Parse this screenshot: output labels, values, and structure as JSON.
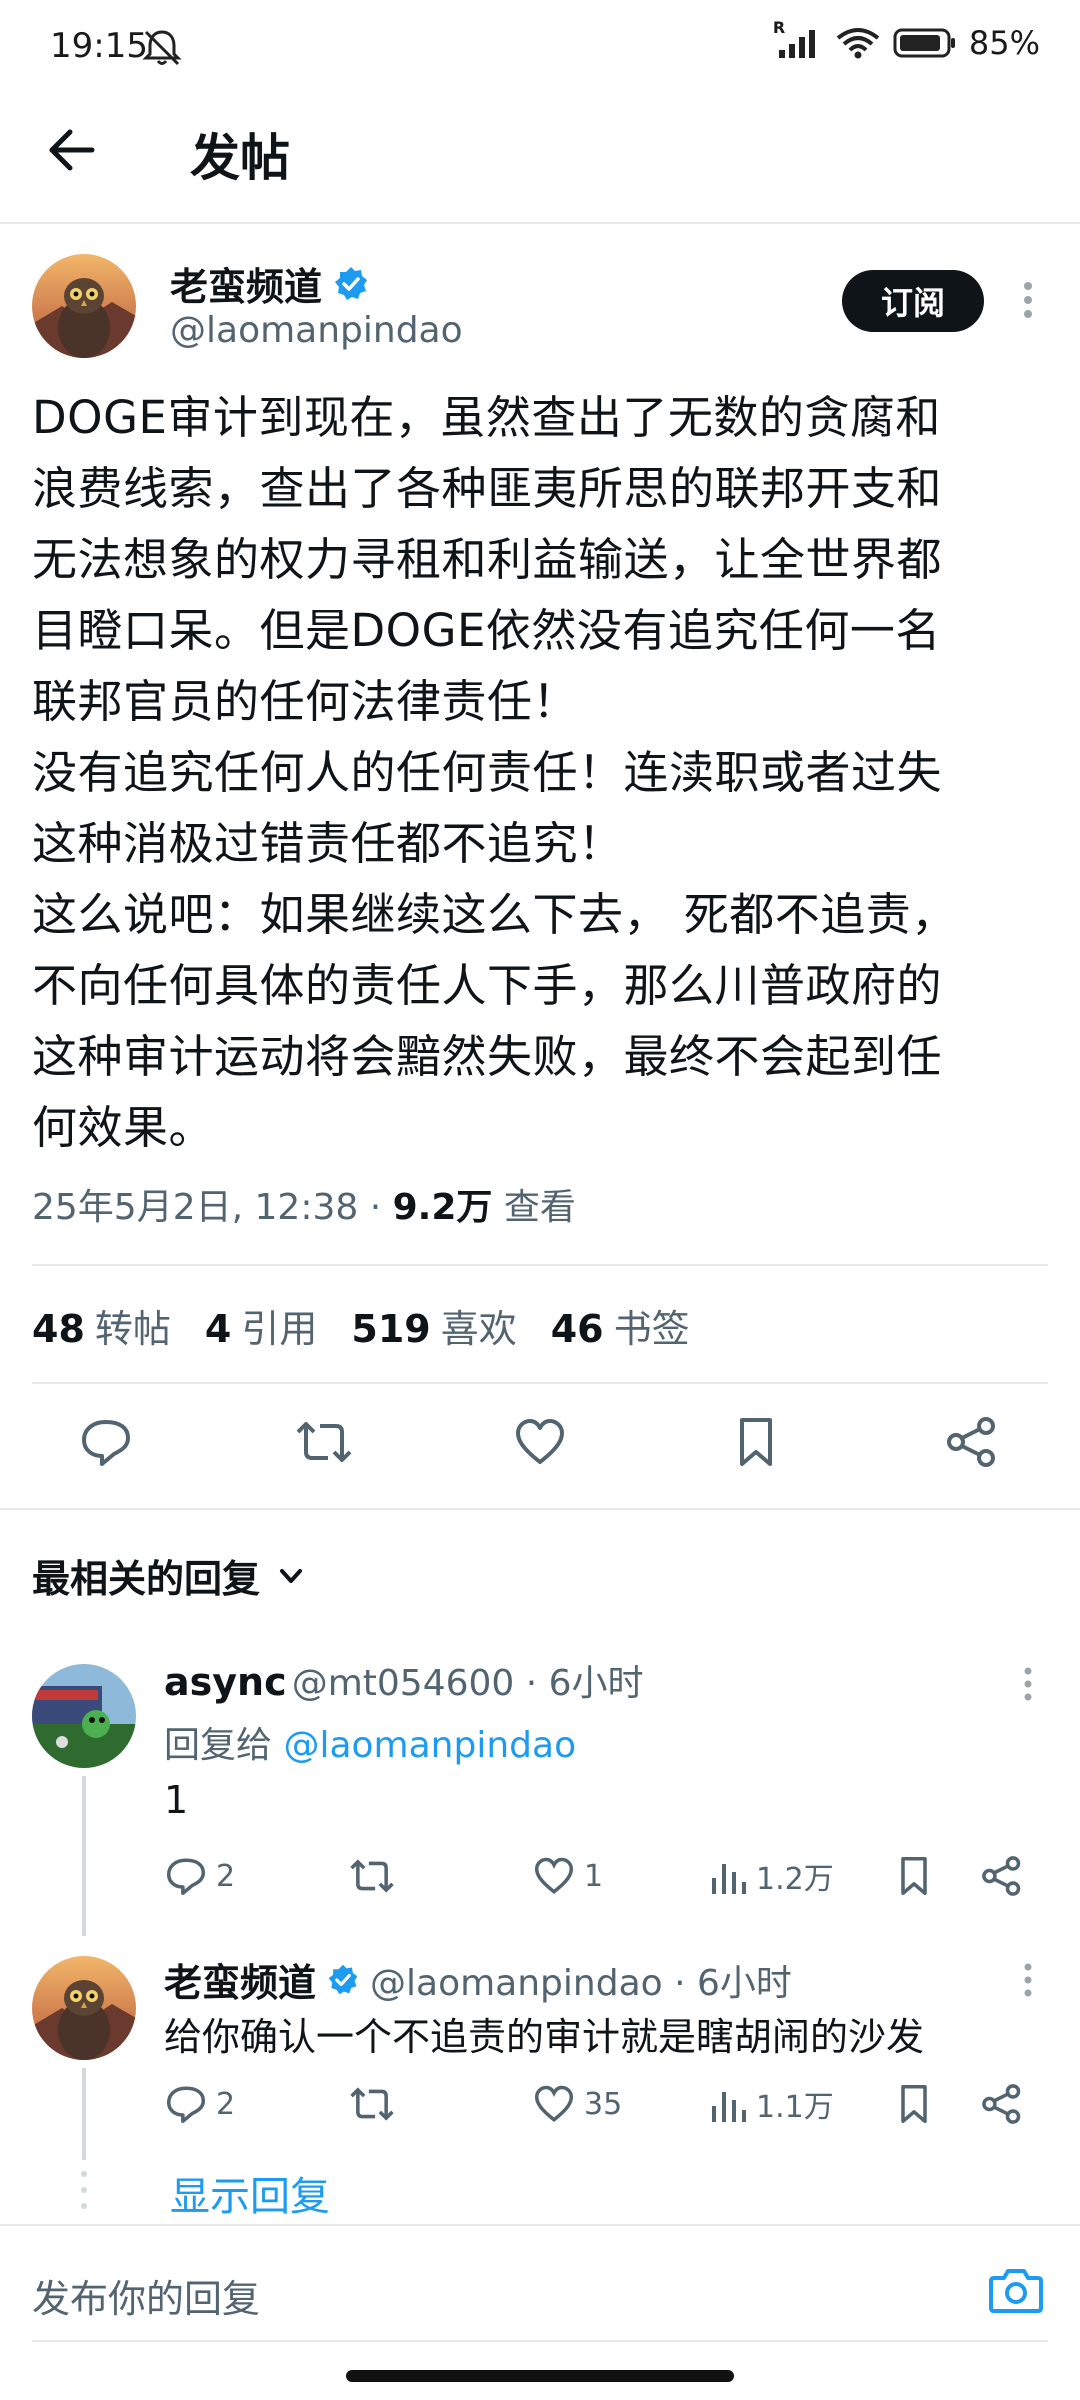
{
  "status_bar": {
    "time": "19:15",
    "signal_label": "R",
    "battery_percent": "85%",
    "icons": [
      "bell-off-icon",
      "signal-icon",
      "wifi-icon",
      "battery-icon"
    ]
  },
  "header": {
    "title": "发帖",
    "back_icon": "arrow-left-icon"
  },
  "tweet": {
    "author_name": "老蛮频道",
    "author_handle": "@laomanpindao",
    "verified": true,
    "subscribe_label": "订阅",
    "text": "DOGE审计到现在，虽然查出了无数的贪腐和\n浪费线索，查出了各种匪夷所思的联邦开支和\n无法想象的权力寻租和利益输送，让全世界都\n目瞪口呆。但是DOGE依然没有追究任何一名\n联邦官员的任何法律责任！\n没有追究任何人的任何责任！连渎职或者过失\n这种消极过错责任都不追究！\n这么说吧：如果继续这么下去， 死都不追责，\n不向任何具体的责任人下手，那么川普政府的\n这种审计运动将会黯然失败，最终不会起到任\n何效果。",
    "date": "25年5月2日, 12:38 · ",
    "views_count": "9.2万",
    "views_label": " 查看",
    "stats": [
      {
        "num": "48",
        "label": "转帖"
      },
      {
        "num": "4",
        "label": "引用"
      },
      {
        "num": "519",
        "label": "喜欢"
      },
      {
        "num": "46",
        "label": "书签"
      }
    ],
    "actions": [
      "reply-icon",
      "retweet-icon",
      "like-icon",
      "bookmark-icon",
      "share-icon"
    ]
  },
  "replies_section": {
    "sort_label": "最相关的回复",
    "replies": [
      {
        "name": "async",
        "handle": "@mt054600",
        "time": " · 6小时",
        "reply_to_prefix": "回复给 ",
        "reply_to_handle": "@laomanpindao",
        "text": "1",
        "replies_count": "2",
        "likes_count": "1",
        "views_count": "1.2万"
      },
      {
        "name": "老蛮频道",
        "handle": "@laomanpindao",
        "time": " · 6小时",
        "text": "给你确认一个不追责的审计就是瞎胡闹的沙发",
        "replies_count": "2",
        "likes_count": "35",
        "views_count": "1.1万"
      }
    ],
    "show_replies_label": "显示回复"
  },
  "composer": {
    "placeholder": "发布你的回复",
    "camera_icon": "camera-icon"
  },
  "colors": {
    "accent": "#1d9bf0",
    "text": "#0f1419",
    "muted": "#536471",
    "divider": "#e6e8ea"
  }
}
